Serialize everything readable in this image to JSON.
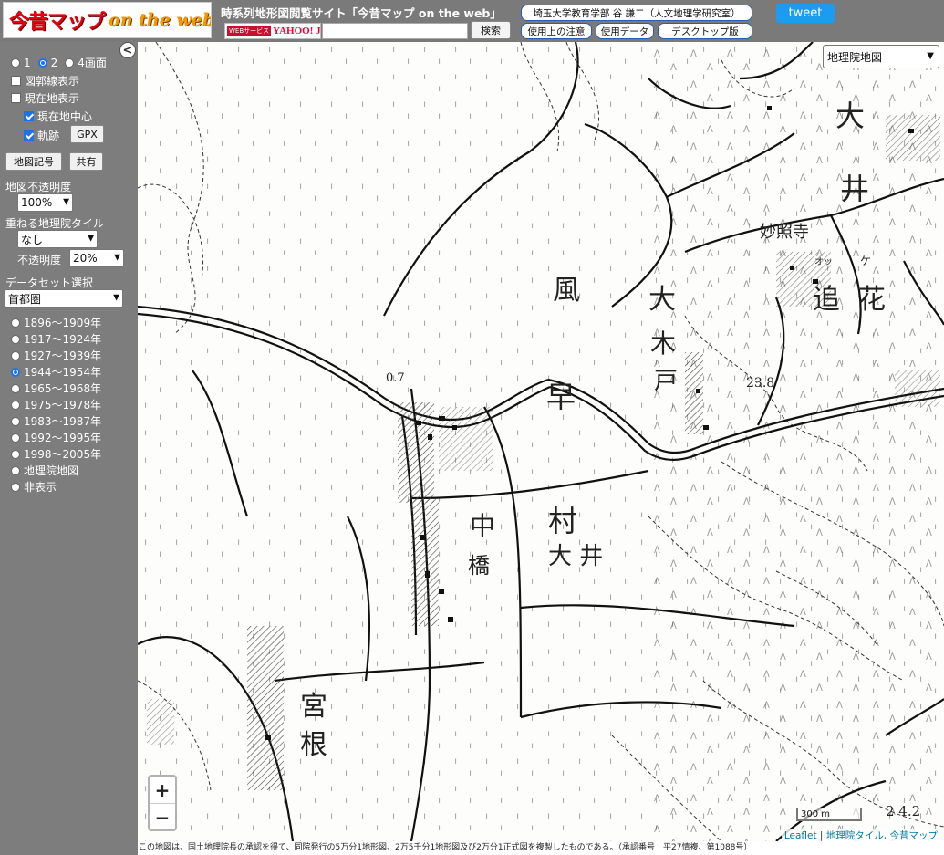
{
  "header": {
    "logo_main": "今昔マップ",
    "logo_sub": "on the web",
    "site_title": "時系列地形図閲覧サイト「今昔マップ on the web」",
    "yahoo_badge_prefix": "WEBサービス",
    "yahoo_badge_brand": "YAHOO! JAPAN",
    "search_value": "",
    "search_button": "検索",
    "affiliation": "埼玉大学教育学部 谷 謙二（人文地理学研究室）",
    "usage_notes": "使用上の注意",
    "usage_data": "使用データ",
    "desktop": "デスクトップ版",
    "tweet": "tweet"
  },
  "sidebar": {
    "collapse": "<",
    "screens": [
      {
        "label": "1",
        "selected": false
      },
      {
        "label": "2",
        "selected": true
      },
      {
        "label": "4画面",
        "selected": false
      }
    ],
    "show_grid_lines": {
      "label": "図郭線表示",
      "checked": false
    },
    "show_location": {
      "label": "現在地表示",
      "checked": false
    },
    "center_location": {
      "label": "現在地中心",
      "checked": true
    },
    "track": {
      "label": "軌跡",
      "checked": true
    },
    "gpx_button": "GPX",
    "map_symbols_button": "地図記号",
    "share_button": "共有",
    "opacity_label": "地図不透明度",
    "opacity_value": "100%",
    "overlay_tile_label": "重ねる地理院タイル",
    "overlay_tile_value": "なし",
    "overlay_opacity_label": "不透明度",
    "overlay_opacity_value": "20%",
    "dataset_label": "データセット選択",
    "dataset_value": "首都圏",
    "periods": [
      {
        "label": "1896～1909年",
        "selected": false
      },
      {
        "label": "1917～1924年",
        "selected": false
      },
      {
        "label": "1927～1939年",
        "selected": false
      },
      {
        "label": "1944～1954年",
        "selected": true
      },
      {
        "label": "1965～1968年",
        "selected": false
      },
      {
        "label": "1975～1978年",
        "selected": false
      },
      {
        "label": "1983～1987年",
        "selected": false
      },
      {
        "label": "1992～1995年",
        "selected": false
      },
      {
        "label": "1998～2005年",
        "selected": false
      },
      {
        "label": "地理院地図",
        "selected": false
      },
      {
        "label": "非表示",
        "selected": false
      }
    ]
  },
  "map": {
    "basemap_select": "地理院地図",
    "zoom_in": "+",
    "zoom_out": "−",
    "scale": "300 m",
    "attribution_leaflet": "Leaflet",
    "attribution_sep": " | ",
    "attribution_tiles": "地理院タイル, 今昔マップ",
    "labels": {
      "kaze": "風",
      "haya": "早",
      "o": "大",
      "ki": "木",
      "to": "戸",
      "myoshoji": "妙照寺",
      "oi_kana": "オッ",
      "ke_kana": "ケ",
      "oi": "追",
      "hana": "花",
      "dai": "大",
      "i": "井",
      "mura": "村",
      "naka": "中",
      "hashi": "橋",
      "ooi": "大 井",
      "miya": "宮",
      "ne": "根",
      "spot1": "23.8",
      "spot2": "2 4.2",
      "spot3": "0.7"
    },
    "footer_note": "この地図は、国土地理院長の承認を得て、同院発行の5万分1地形図、2万5千分1地形図及び2万分1正式図を複製したものである。（承認番号　平27情複、第1088号）"
  }
}
